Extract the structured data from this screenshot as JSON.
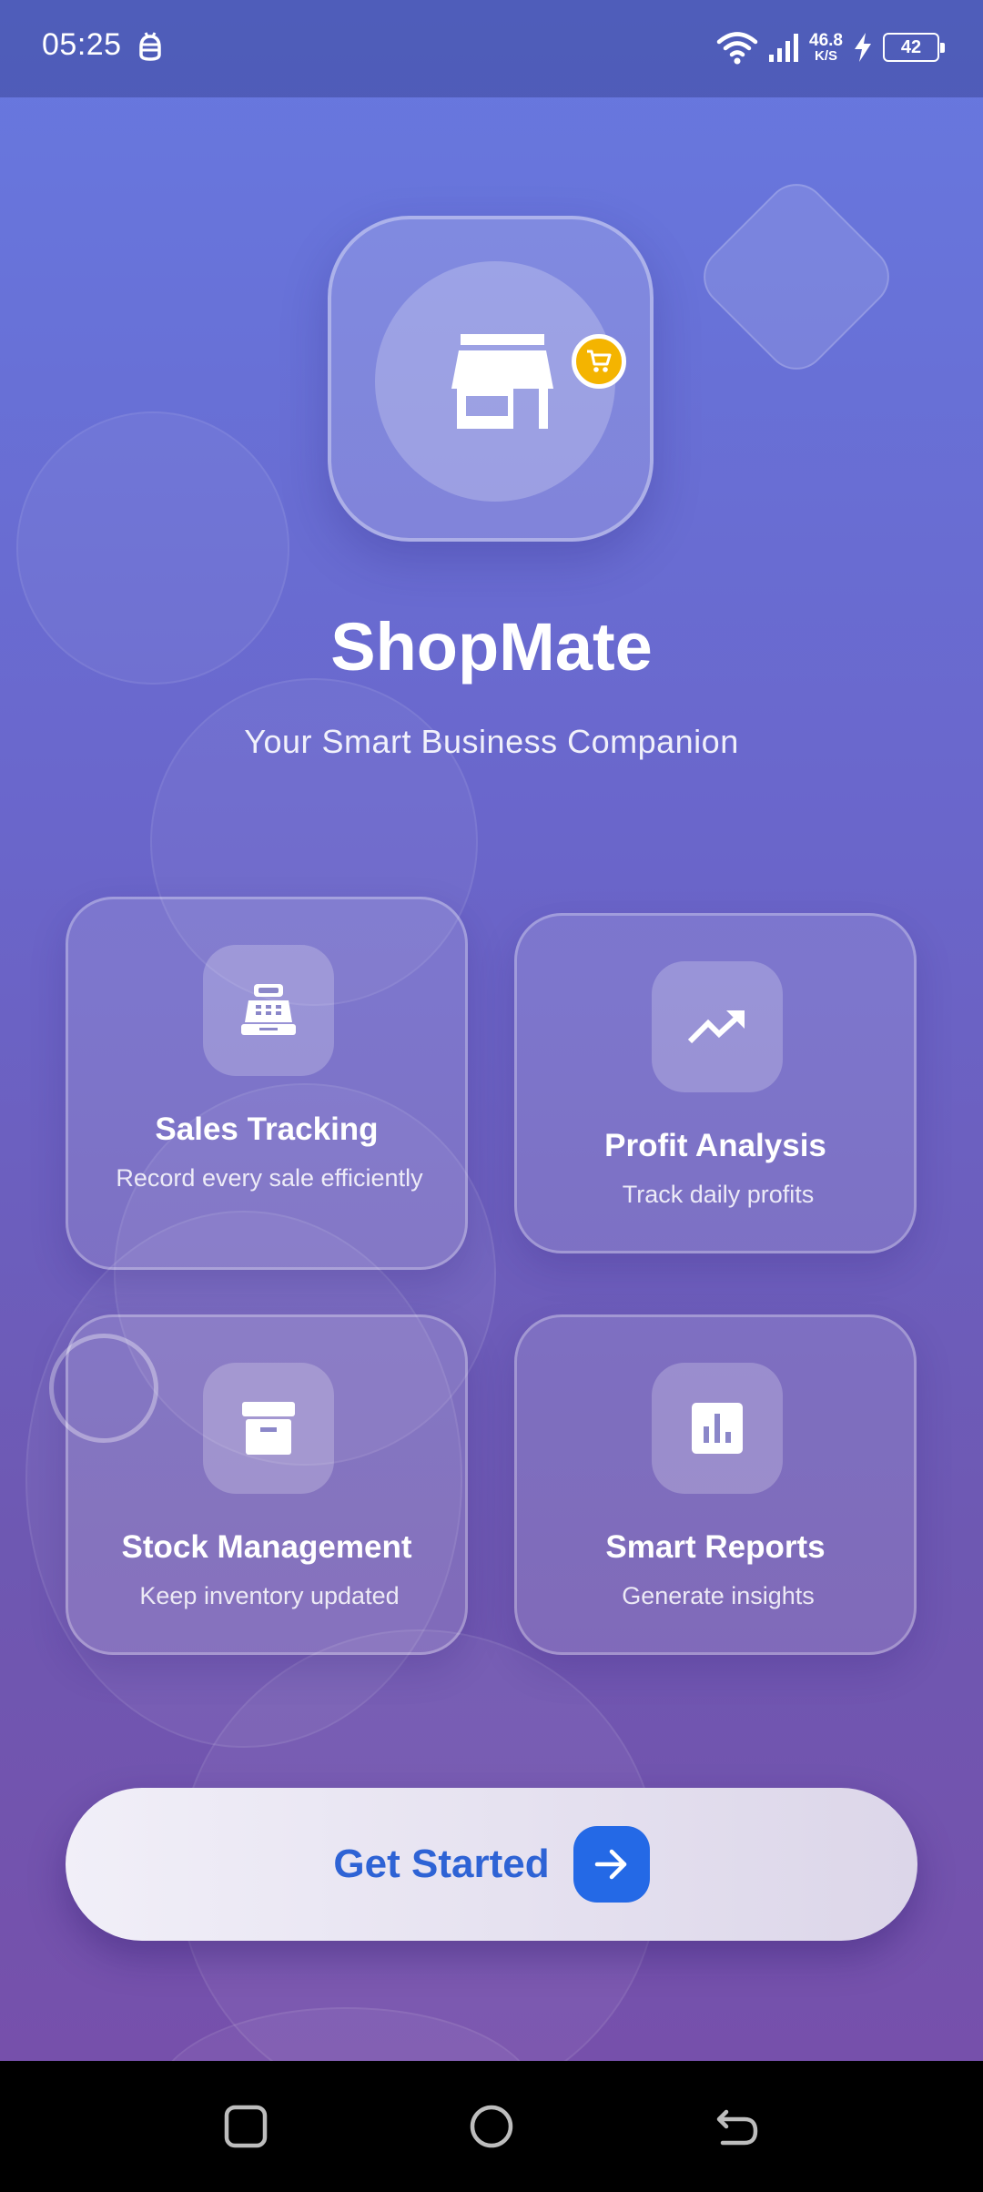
{
  "status_bar": {
    "time": "05:25",
    "network_speed_value": "46.8",
    "network_speed_unit": "K/S",
    "battery_level": "42",
    "icons": [
      "notification-icon",
      "wifi-icon",
      "signal-icon",
      "charging-icon",
      "battery-icon"
    ]
  },
  "app": {
    "title": "ShopMate",
    "subtitle": "Your Smart Business Companion",
    "logo_icon": "store-icon",
    "badge_icon": "cart-icon",
    "badge_color": "#f4b400"
  },
  "features": [
    {
      "icon": "cash-register-icon",
      "title": "Sales Tracking",
      "description": "Record every sale efficiently"
    },
    {
      "icon": "trending-up-icon",
      "title": "Profit Analysis",
      "description": "Track daily profits"
    },
    {
      "icon": "archive-box-icon",
      "title": "Stock Management",
      "description": "Keep inventory updated"
    },
    {
      "icon": "bar-chart-icon",
      "title": "Smart Reports",
      "description": "Generate insights"
    }
  ],
  "cta": {
    "label": "Get Started",
    "icon": "arrow-right-icon",
    "accent": "#2469e6"
  },
  "nav_bar": {
    "buttons": [
      "recents-button",
      "home-button",
      "back-button"
    ]
  }
}
